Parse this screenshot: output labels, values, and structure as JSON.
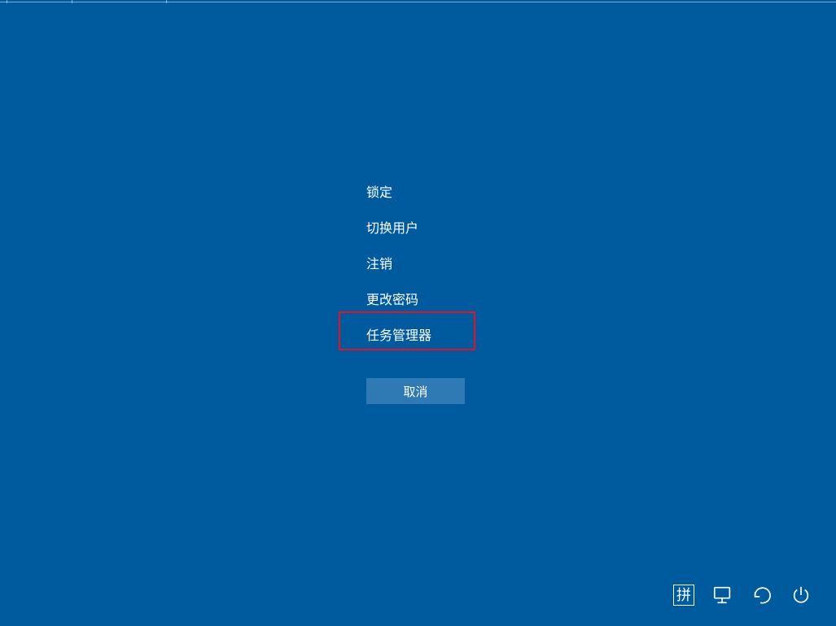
{
  "options": {
    "lock": "锁定",
    "switch_user": "切换用户",
    "sign_out": "注销",
    "change_pw": "更改密码",
    "task_mgr": "任务管理器"
  },
  "cancel_label": "取消",
  "ime_label": "拼",
  "highlight": {
    "target": "task_mgr",
    "color": "#e81123"
  },
  "colors": {
    "background": "#005a9e",
    "button_bg": "#2f7ab4",
    "text": "#ffffff"
  },
  "icons": {
    "ime": "ime-icon",
    "network": "network-icon",
    "ease_of_access": "ease-of-access-icon",
    "power": "power-icon"
  }
}
